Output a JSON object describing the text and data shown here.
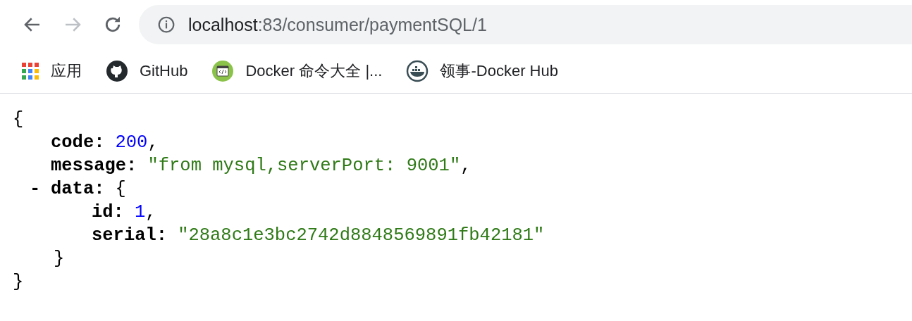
{
  "navigation": {
    "back_disabled": false,
    "forward_disabled": true
  },
  "address_bar": {
    "host": "localhost",
    "path": ":83/consumer/paymentSQL/1"
  },
  "bookmarks": [
    {
      "label": "应用"
    },
    {
      "label": "GitHub"
    },
    {
      "label": "Docker 命令大全 |..."
    },
    {
      "label": "领事-Docker Hub"
    }
  ],
  "json_view": {
    "open": "{",
    "close": "}",
    "members": [
      {
        "key": "code:",
        "value": "200",
        "kind": "number",
        "comma": ","
      },
      {
        "key": "message:",
        "value": "\"from mysql,serverPort: 9001\"",
        "kind": "string",
        "comma": ","
      },
      {
        "key": "data:",
        "toggle": "-",
        "expanded": true,
        "open": "{",
        "close": "}",
        "members": [
          {
            "key": "id:",
            "value": "1",
            "kind": "number",
            "comma": ","
          },
          {
            "key": "serial:",
            "value": "\"28a8c1e3bc2742d8848569891fb42181\"",
            "kind": "string"
          }
        ]
      }
    ]
  }
}
